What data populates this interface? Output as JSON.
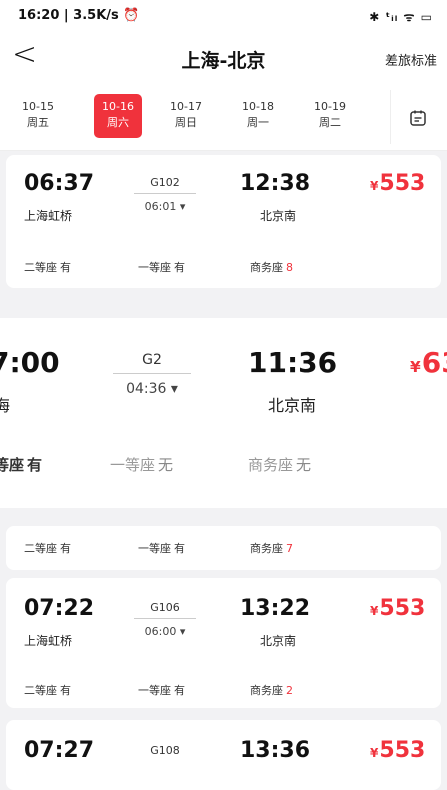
{
  "status": {
    "left": "16:20 | 3.5K/s ⏰",
    "right": "✱ ᵗᵢₗ ᯤ ▭"
  },
  "header": {
    "back": "<",
    "title": "上海-北京",
    "policy": "差旅标准"
  },
  "dates": [
    {
      "d": "10-15",
      "w": "周五"
    },
    {
      "d": "10-16",
      "w": "周六"
    },
    {
      "d": "10-17",
      "w": "周日"
    },
    {
      "d": "10-18",
      "w": "周一"
    },
    {
      "d": "10-19",
      "w": "周二"
    }
  ],
  "trains": [
    {
      "dep": "06:37",
      "from": "上海虹桥",
      "no": "G102",
      "dur": "06:01",
      "arr": "12:38",
      "to": "北京南",
      "price": "553",
      "seats": [
        {
          "name": "二等座",
          "cnt": "有"
        },
        {
          "name": "一等座",
          "cnt": "有"
        },
        {
          "name": "商务座",
          "cnt": "8"
        }
      ]
    },
    {
      "dep": "7:00",
      "from": "海",
      "no": "G2",
      "dur": "04:36",
      "arr": "11:36",
      "to": "北京南",
      "price": "63",
      "seats": [
        {
          "name": "等座",
          "cnt": "有"
        },
        {
          "name": "一等座",
          "cnt": "无"
        },
        {
          "name": "商务座",
          "cnt": "无"
        }
      ]
    },
    {
      "seats": [
        {
          "name": "二等座",
          "cnt": "有"
        },
        {
          "name": "一等座",
          "cnt": "有"
        },
        {
          "name": "商务座",
          "cnt": "7"
        }
      ]
    },
    {
      "dep": "07:22",
      "from": "上海虹桥",
      "no": "G106",
      "dur": "06:00",
      "arr": "13:22",
      "to": "北京南",
      "price": "553",
      "seats": [
        {
          "name": "二等座",
          "cnt": "有"
        },
        {
          "name": "一等座",
          "cnt": "有"
        },
        {
          "name": "商务座",
          "cnt": "2"
        }
      ]
    },
    {
      "dep": "07:27",
      "no": "G108",
      "arr": "13:36",
      "price": "553"
    }
  ],
  "duration_suffix": "▾",
  "yen": "¥"
}
